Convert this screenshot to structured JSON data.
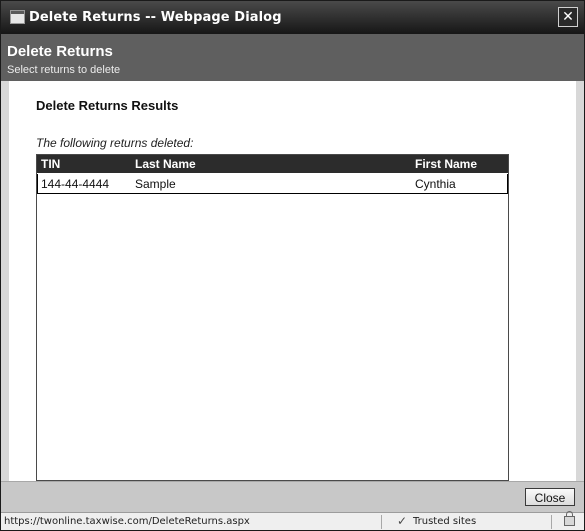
{
  "window": {
    "title": "Delete Returns -- Webpage Dialog",
    "close_glyph": "✕"
  },
  "header": {
    "title": "Delete Returns",
    "subtitle": "Select returns to delete"
  },
  "main": {
    "heading": "Delete Returns Results",
    "note": "The following returns deleted:",
    "table": {
      "columns": [
        "TIN",
        "Last Name",
        "First Name"
      ],
      "rows": [
        [
          "144-44-4444",
          "Sample",
          "Cynthia"
        ]
      ]
    }
  },
  "footer": {
    "close_label": "Close"
  },
  "statusbar": {
    "url": "https://twonline.taxwise.com/DeleteReturns.aspx",
    "zone": "Trusted sites",
    "zone_icon": "check-icon",
    "lock_icon": "lock-icon"
  }
}
